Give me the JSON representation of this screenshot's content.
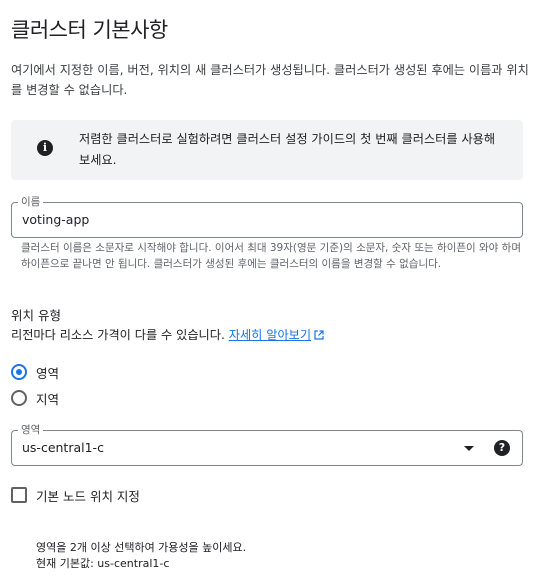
{
  "page_title": "클러스터 기본사항",
  "intro_text": "여기에서 지정한 이름, 버전, 위치의 새 클러스터가 생성됩니다. 클러스터가 생성된 후에는 이름과 위치를 변경할 수 없습니다.",
  "info_banner": {
    "icon": "info-icon",
    "text": "저렴한 클러스터로 실험하려면 클러스터 설정 가이드의 첫 번째 클러스터를 사용해 보세요."
  },
  "name_field": {
    "label": "이름",
    "value": "voting-app",
    "hint": "클러스터 이름은 소문자로 시작해야 합니다. 이어서 최대 39자(영문 기준)의 소문자, 숫자 또는 하이픈이 와야 하며 하이픈으로 끝나면 안 됩니다. 클러스터가 생성된 후에는 클러스터의 이름을 변경할 수 없습니다."
  },
  "location_type": {
    "label": "위치 유형",
    "price_note": "리전마다 리소스 가격이 다를 수 있습니다.",
    "learn_more": "자세히 알아보기",
    "options": [
      {
        "label": "영역",
        "selected": true
      },
      {
        "label": "지역",
        "selected": false
      }
    ]
  },
  "zone_select": {
    "label": "영역",
    "value": "us-central1-c"
  },
  "node_locations": {
    "checkbox_label": "기본 노드 위치 지정",
    "checked": false,
    "note_line1": "영역을 2개 이상 선택하여 가용성을 높이세요.",
    "note_line2": "현재 기본값: us-central1-c"
  },
  "colors": {
    "accent": "#1a73e8",
    "banner_bg": "#f1f3f4",
    "text": "#202124",
    "secondary_text": "#5f6368"
  }
}
